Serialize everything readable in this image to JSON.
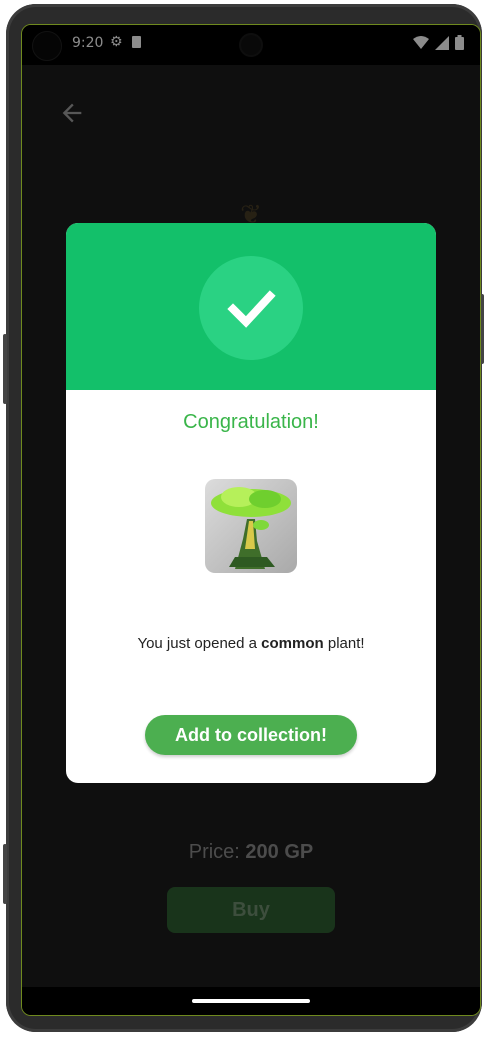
{
  "status_bar": {
    "time": "9:20",
    "left_icons": [
      "gear-icon",
      "sd-card-icon"
    ],
    "right_icons": [
      "wifi-icon",
      "signal-icon",
      "battery-icon"
    ]
  },
  "toolbar": {
    "back_icon": "arrow-left-icon"
  },
  "dialog": {
    "header_icon": "checkmark-icon",
    "title": "Congratulation!",
    "message_prefix": "You just opened a ",
    "message_bold": "common",
    "message_suffix": " plant!",
    "button_label": "Add to collection!"
  },
  "shop": {
    "price_label": "Price: ",
    "price_value": "200 GP",
    "buy_label": "Buy"
  },
  "colors": {
    "header_green": "#13c06a",
    "title_green": "#3ab54a",
    "button_green": "#4caf50",
    "buy_green_dimmed": "#2f5f32"
  }
}
